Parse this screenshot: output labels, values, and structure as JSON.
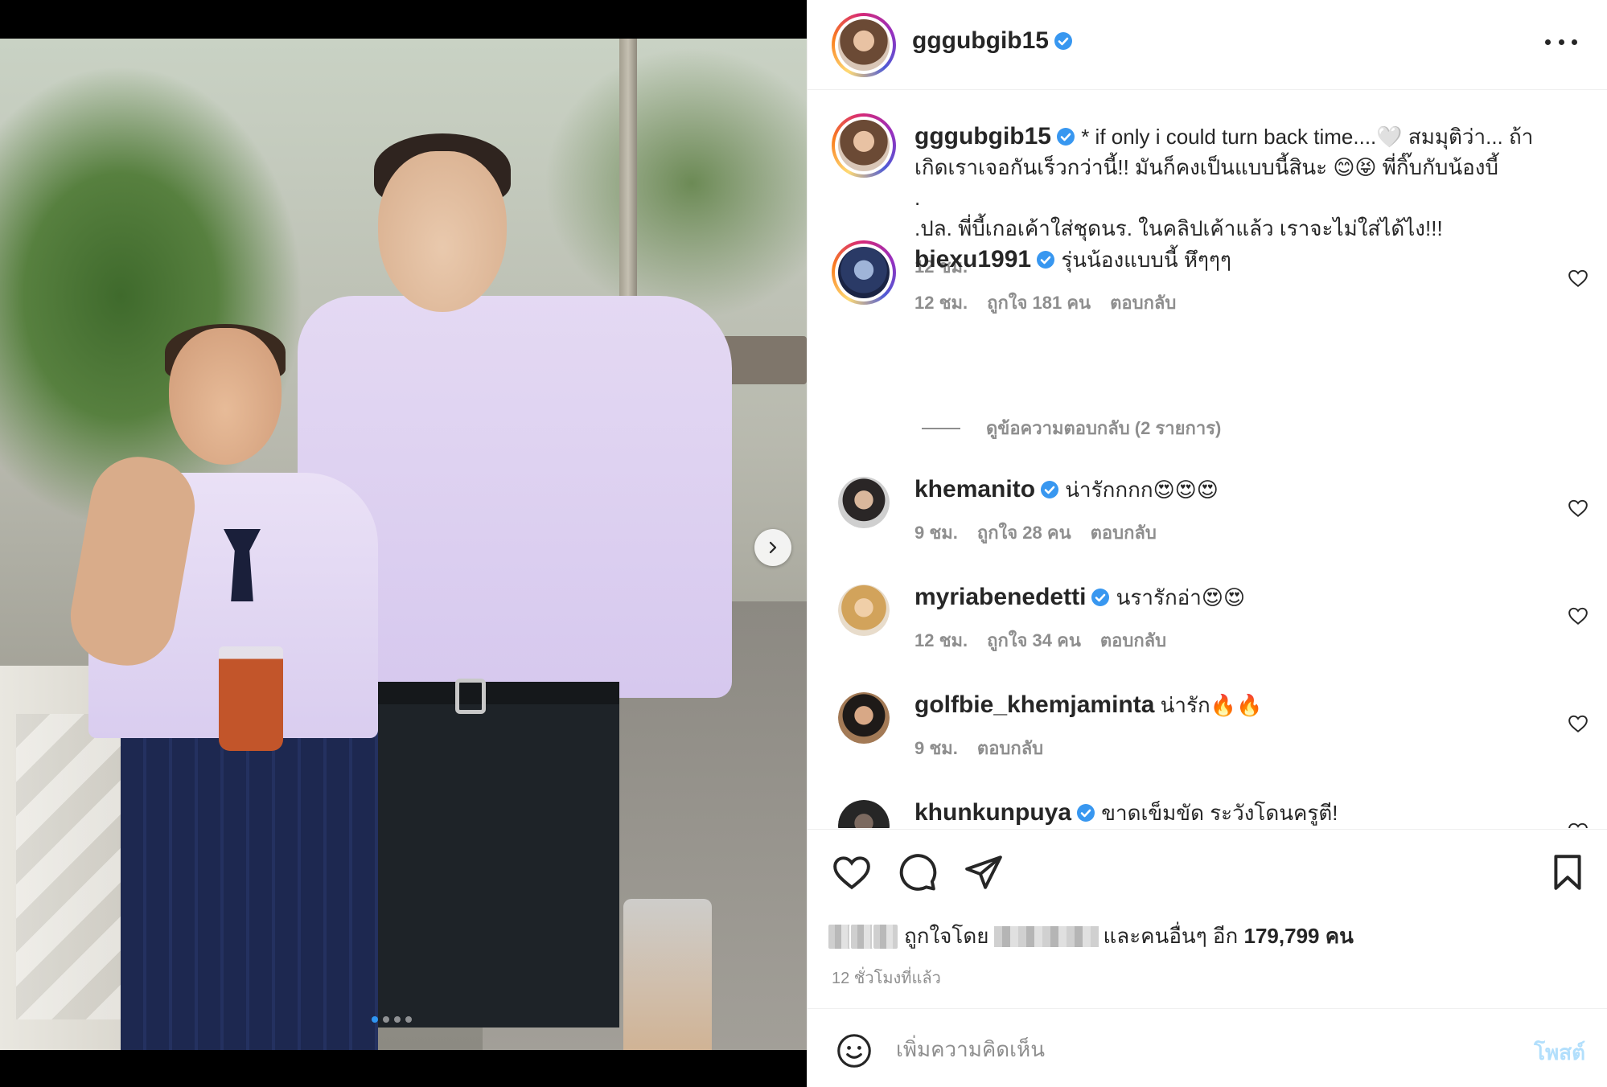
{
  "post": {
    "username": "gggubgib15",
    "caption": "* if only i could turn back time....🤍 สมมุติว่า... ถ้าเกิดเราเจอกันเร็วกว่านี้!! มันก็คงเป็นแบบนี้สินะ 😊😝 พี่กิ๊บกับน้องบี้",
    "caption_dot": ".",
    "caption_ps": ".ปล. พี่บี้เกอเค้าใส่ชุดนร. ในคลิปเค้าแล้ว เราจะไม่ใส่ได้ไง!!!",
    "caption_time": "12 ชม."
  },
  "comments": [
    {
      "username": "biexu1991",
      "verified": true,
      "text": "รุ่นน้องแบบนี้ หึๆๆๆ",
      "time": "12 ชม.",
      "likes": "ถูกใจ 181 คน",
      "reply": "ตอบกลับ"
    },
    {
      "username": "khemanito",
      "verified": true,
      "text": "น่ารักกกก😍😍😍",
      "time": "9 ชม.",
      "likes": "ถูกใจ 28 คน",
      "reply": "ตอบกลับ"
    },
    {
      "username": "myriabenedetti",
      "verified": true,
      "text": "นรารักอ่า😍😍",
      "time": "12 ชม.",
      "likes": "ถูกใจ 34 คน",
      "reply": "ตอบกลับ"
    },
    {
      "username": "golfbie_khemjaminta",
      "verified": false,
      "text": "น่ารัก🔥🔥",
      "time": "9 ชม.",
      "likes": "",
      "reply": "ตอบกลับ"
    },
    {
      "username": "khunkunpuya",
      "verified": true,
      "text": "ขาดเข็มขัด ระวังโดนครูตี!",
      "time": "",
      "likes": "",
      "reply": ""
    }
  ],
  "view_replies": "ดูข้อความตอบกลับ (2 รายการ)",
  "likes_bar": {
    "liked_by": "ถูกใจโดย",
    "and_others": "และคนอื่นๆ อีก",
    "count": "179,799 คน",
    "posted_ago": "12 ชั่วโมงที่แล้ว"
  },
  "comment_box": {
    "placeholder": "เพิ่มความคิดเห็น",
    "post_label": "โพสต์"
  },
  "carousel": {
    "total": 4,
    "active": 1
  },
  "colors": {
    "accent": "#0095f6",
    "muted": "#8e8e8e",
    "verified": "#3897f0"
  },
  "icons": [
    "more-icon",
    "heart-icon",
    "comment-icon",
    "share-icon",
    "bookmark-icon",
    "emoji-icon",
    "chevron-right-icon",
    "verified-icon"
  ]
}
